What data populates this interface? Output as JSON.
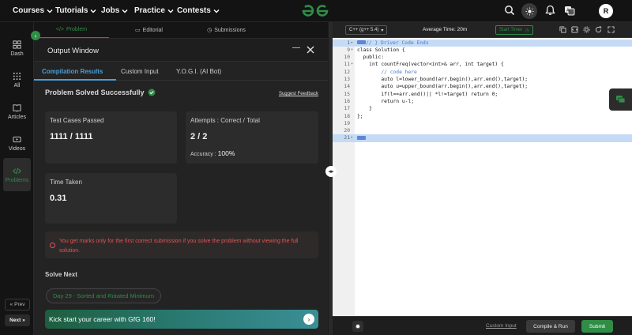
{
  "nav": {
    "items": [
      "Courses",
      "Tutorials",
      "Jobs",
      "Practice",
      "Contests"
    ],
    "avatar": "R"
  },
  "sidebar": {
    "items": [
      {
        "label": "Dash",
        "icon": "dashboard-icon"
      },
      {
        "label": "All",
        "icon": "grid-icon"
      },
      {
        "label": "Articles",
        "icon": "book-icon"
      },
      {
        "label": "Videos",
        "icon": "video-icon"
      },
      {
        "label": "Problems",
        "icon": "code-icon"
      }
    ],
    "prev": "Prev",
    "next": "Next"
  },
  "problem_tabs": [
    "Problem",
    "Editorial",
    "Submissions"
  ],
  "output": {
    "title": "Output Window",
    "tabs": [
      "Compilation Results",
      "Custom Input",
      "Y.O.G.I. (AI Bot)"
    ],
    "status": "Problem Solved Successfully",
    "suggest_feedback": "Suggest Feedback",
    "test_cases_label": "Test Cases Passed",
    "test_cases_value": "1111 / 1111",
    "attempts_label": "Attempts : Correct / Total",
    "attempts_value": "2 / 2",
    "accuracy_label": "Accuracy :",
    "accuracy_value": "100%",
    "time_label": "Time Taken",
    "time_value": "0.31",
    "warning": "You get marks only for the first correct submission if you solve the problem without viewing the full solution.",
    "solve_next": "Solve Next",
    "next_problem": "Day 29 - Sorted and Rotated Minimum",
    "banner": "Kick start your career with GfG 160!"
  },
  "editor": {
    "language": "C++ (g++ 5.4)",
    "average_time": "Average Time: 20m",
    "start_timer": "Start Timer",
    "lines": [
      {
        "n": "1",
        "marker": "▸",
        "text": "// } Driver Code Ends",
        "hl": true,
        "fold": true
      },
      {
        "n": "9",
        "marker": "▾",
        "text": "class Solution {"
      },
      {
        "n": "10",
        "marker": "",
        "text": "  public:"
      },
      {
        "n": "11",
        "marker": "▾",
        "text": "    int countFreq(vector<int>& arr, int target) {"
      },
      {
        "n": "12",
        "marker": "",
        "text": "        // code here"
      },
      {
        "n": "13",
        "marker": "",
        "text": "        auto l=lower_bound(arr.begin(),arr.end(),target);"
      },
      {
        "n": "14",
        "marker": "",
        "text": "        auto u=upper_bound(arr.begin(),arr.end(),target);"
      },
      {
        "n": "15",
        "marker": "",
        "text": "        if(l==arr.end()|| *l!=target) return 0;"
      },
      {
        "n": "16",
        "marker": "",
        "text": "        return u-l;"
      },
      {
        "n": "17",
        "marker": "",
        "text": "    }"
      },
      {
        "n": "18",
        "marker": "",
        "text": "};"
      },
      {
        "n": "19",
        "marker": "",
        "text": ""
      },
      {
        "n": "20",
        "marker": "",
        "text": ""
      },
      {
        "n": "21",
        "marker": "▸",
        "text": "",
        "hl": true,
        "fold": true
      }
    ],
    "custom_input": "Custom Input",
    "compile_run": "Compile & Run",
    "submit": "Submit"
  },
  "colors": {
    "accent": "#2f8d46",
    "tab_active": "#4a9fd6",
    "warning": "#e05555"
  }
}
